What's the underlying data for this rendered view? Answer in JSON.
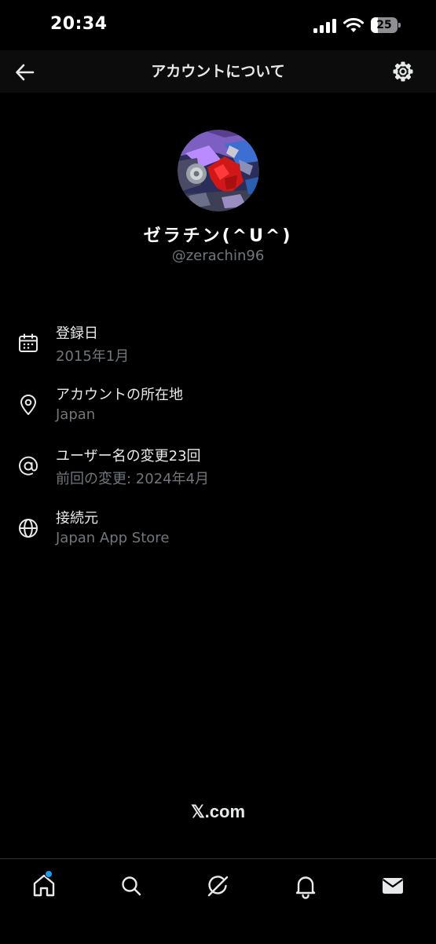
{
  "status_bar": {
    "time": "20:34",
    "battery_level": "25",
    "battery_fraction": 0.25
  },
  "header": {
    "title": "アカウントについて",
    "back_icon": "arrow-left-icon",
    "settings_icon": "gear-icon"
  },
  "profile": {
    "display_name": "ゼラチン(^U^)",
    "handle": "@zerachin96"
  },
  "info_rows": [
    {
      "icon": "calendar-icon",
      "label": "登録日",
      "value": "2015年1月"
    },
    {
      "icon": "location-pin-icon",
      "label": "アカウントの所在地",
      "value": "Japan"
    },
    {
      "icon": "at-sign-icon",
      "label": "ユーザー名の変更23回",
      "value": "前回の変更: 2024年4月"
    },
    {
      "icon": "globe-icon",
      "label": "接続元",
      "value": "Japan App Store"
    }
  ],
  "footer": {
    "brand": "𝕏.com"
  },
  "tab_bar": {
    "tabs": [
      "home-icon",
      "search-icon",
      "grok-icon",
      "bell-icon",
      "mail-icon"
    ],
    "home_has_notification": true
  },
  "colors": {
    "background": "#000000",
    "header_background": "#0c0c0c",
    "primary_text": "#e7e9ea",
    "secondary_text": "#71767b",
    "accent": "#1d9bf0"
  }
}
